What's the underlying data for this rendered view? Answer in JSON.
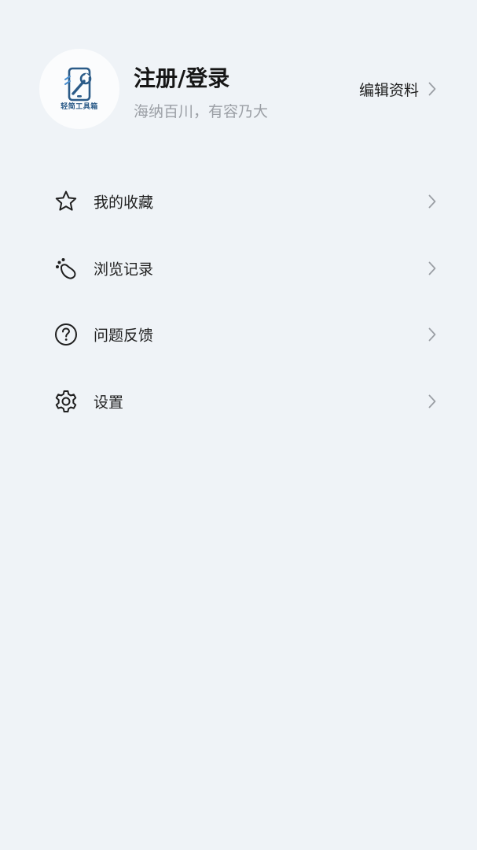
{
  "profile": {
    "logo_text": "轻简工具箱",
    "login_title": "注册/登录",
    "slogan": "海纳百川，有容乃大",
    "edit_label": "编辑资料"
  },
  "menu": {
    "items": [
      {
        "label": "我的收藏",
        "icon": "star-icon"
      },
      {
        "label": "浏览记录",
        "icon": "footprint-icon"
      },
      {
        "label": "问题反馈",
        "icon": "question-circle-icon"
      },
      {
        "label": "设置",
        "icon": "gear-icon"
      }
    ]
  },
  "colors": {
    "background": "#eff3f7",
    "text_primary": "#1f1f1f",
    "text_secondary": "#9b9fa5",
    "chevron": "#9a9ea4",
    "logo_blue": "#2b5b88"
  }
}
